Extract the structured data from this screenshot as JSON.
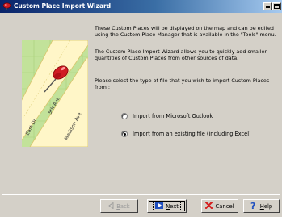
{
  "window": {
    "title": "Custom Place Import Wizard",
    "icon": "map-pin-icon",
    "controls": [
      "minimize-icon",
      "maximize-icon"
    ]
  },
  "map": {
    "street_labels": [
      "East Dr",
      "5th Ave",
      "Madison Ave"
    ]
  },
  "content": {
    "para1": "These Custom Places will be displayed on the map and can be edited using the Custom Place Manager that is available in the \"Tools\" menu.",
    "para2": "The Custom Place Import Wizard allows you to quickly add smaller quantities of Custom Places from other sources of data.",
    "para3": "Please select the type of file that you wish to import Custom Places from :"
  },
  "options": [
    {
      "label": "Import from Microsoft Outlook",
      "checked": false
    },
    {
      "label": "Import from an existing file (including Excel)",
      "checked": true
    }
  ],
  "buttons": {
    "back": {
      "prefix": "",
      "u": "B",
      "rest": "ack",
      "icon": "back-arrow-icon",
      "enabled": false
    },
    "next": {
      "prefix": "",
      "u": "N",
      "rest": "ext",
      "icon": "next-arrow-icon",
      "enabled": true
    },
    "cancel": {
      "prefix": "Cancel",
      "icon": "cancel-x-icon"
    },
    "help": {
      "prefix": "",
      "u": "H",
      "rest": "elp",
      "icon": "help-question-icon"
    }
  },
  "colors": {
    "titlebar_start": "#0a246a",
    "titlebar_end": "#a6caf0",
    "dialog_bg": "#d4d0c8",
    "map_green": "#c2e29a",
    "map_road": "#fff6c8",
    "pin_red": "#d01c24",
    "cancel_red": "#d42020",
    "help_blue": "#1f4fbf"
  }
}
